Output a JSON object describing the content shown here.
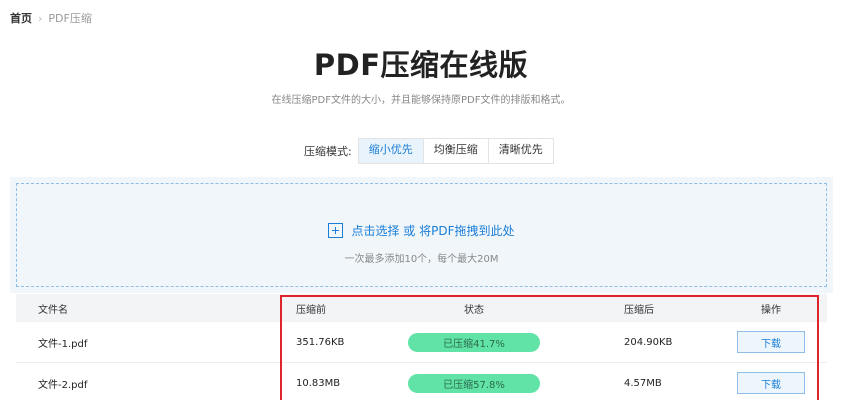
{
  "breadcrumb": {
    "home": "首页",
    "separator": "›",
    "current": "PDF压缩"
  },
  "header": {
    "title": "PDF压缩在线版",
    "subtitle": "在线压缩PDF文件的大小，并且能够保持原PDF文件的排版和格式。"
  },
  "mode": {
    "label": "压缩模式:",
    "options": [
      {
        "label": "缩小优先",
        "active": true
      },
      {
        "label": "均衡压缩",
        "active": false
      },
      {
        "label": "清晰优先",
        "active": false
      }
    ]
  },
  "upload": {
    "icon": "plus-icon",
    "main_text": "点击选择 或 将PDF拖拽到此处",
    "hint": "一次最多添加10个，每个最大20M"
  },
  "table": {
    "headers": {
      "name": "文件名",
      "before": "压缩前",
      "status": "状态",
      "after": "压缩后",
      "op": "操作"
    },
    "rows": [
      {
        "name": "文件-1.pdf",
        "before": "351.76KB",
        "status": "已压缩41.7%",
        "after": "204.90KB",
        "op": "下载"
      },
      {
        "name": "文件-2.pdf",
        "before": "10.83MB",
        "status": "已压缩57.8%",
        "after": "4.57MB",
        "op": "下载"
      }
    ]
  },
  "colors": {
    "accent": "#1a7dd6",
    "status_pill": "#61e3a8",
    "highlight": "#e0242c",
    "upload_bg": "#f1f6fb"
  }
}
